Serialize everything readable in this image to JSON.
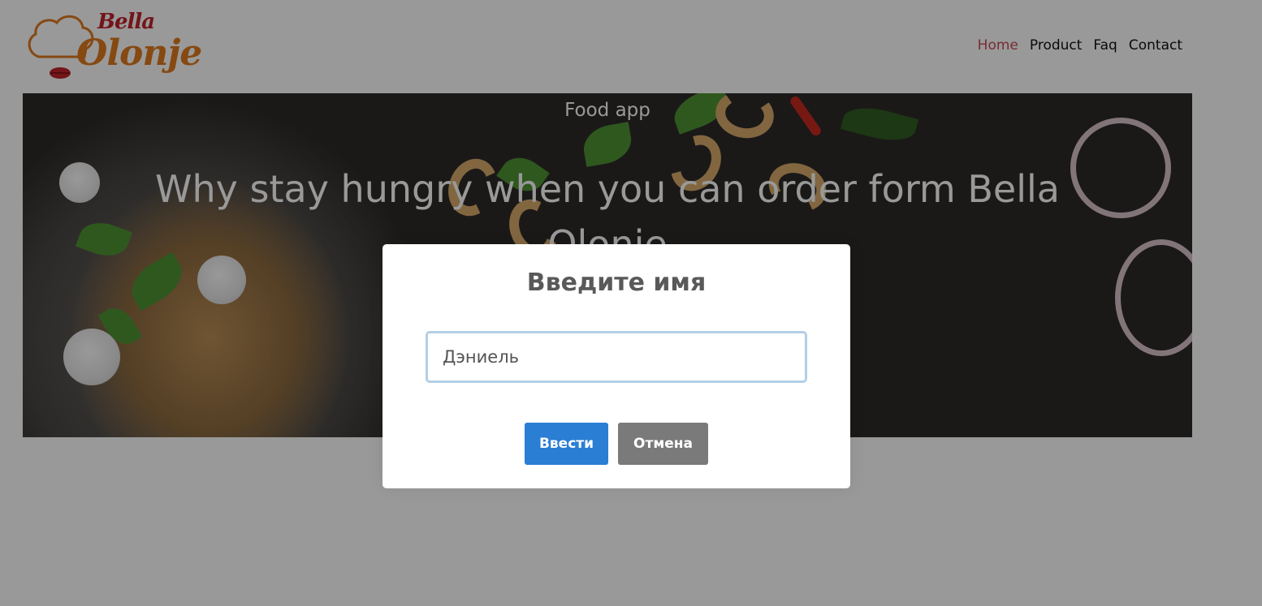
{
  "logo": {
    "line1": "Bella",
    "line2": "Olonje",
    "brand_color": "#e07a1f",
    "accent_color": "#c0242a"
  },
  "nav": {
    "items": [
      {
        "label": "Home",
        "active": true
      },
      {
        "label": "Product",
        "active": false
      },
      {
        "label": "Faq",
        "active": false
      },
      {
        "label": "Contact",
        "active": false
      }
    ],
    "active_color": "#c94b54"
  },
  "hero": {
    "small_title": "Food app",
    "title": "Why stay hungry when you can order form Bella Olonje"
  },
  "modal": {
    "title": "Введите имя",
    "input_value": "Дэниель",
    "confirm_label": "Ввести",
    "cancel_label": "Отмена",
    "confirm_color": "#2a7ed4",
    "cancel_color": "#7a7a7a"
  }
}
